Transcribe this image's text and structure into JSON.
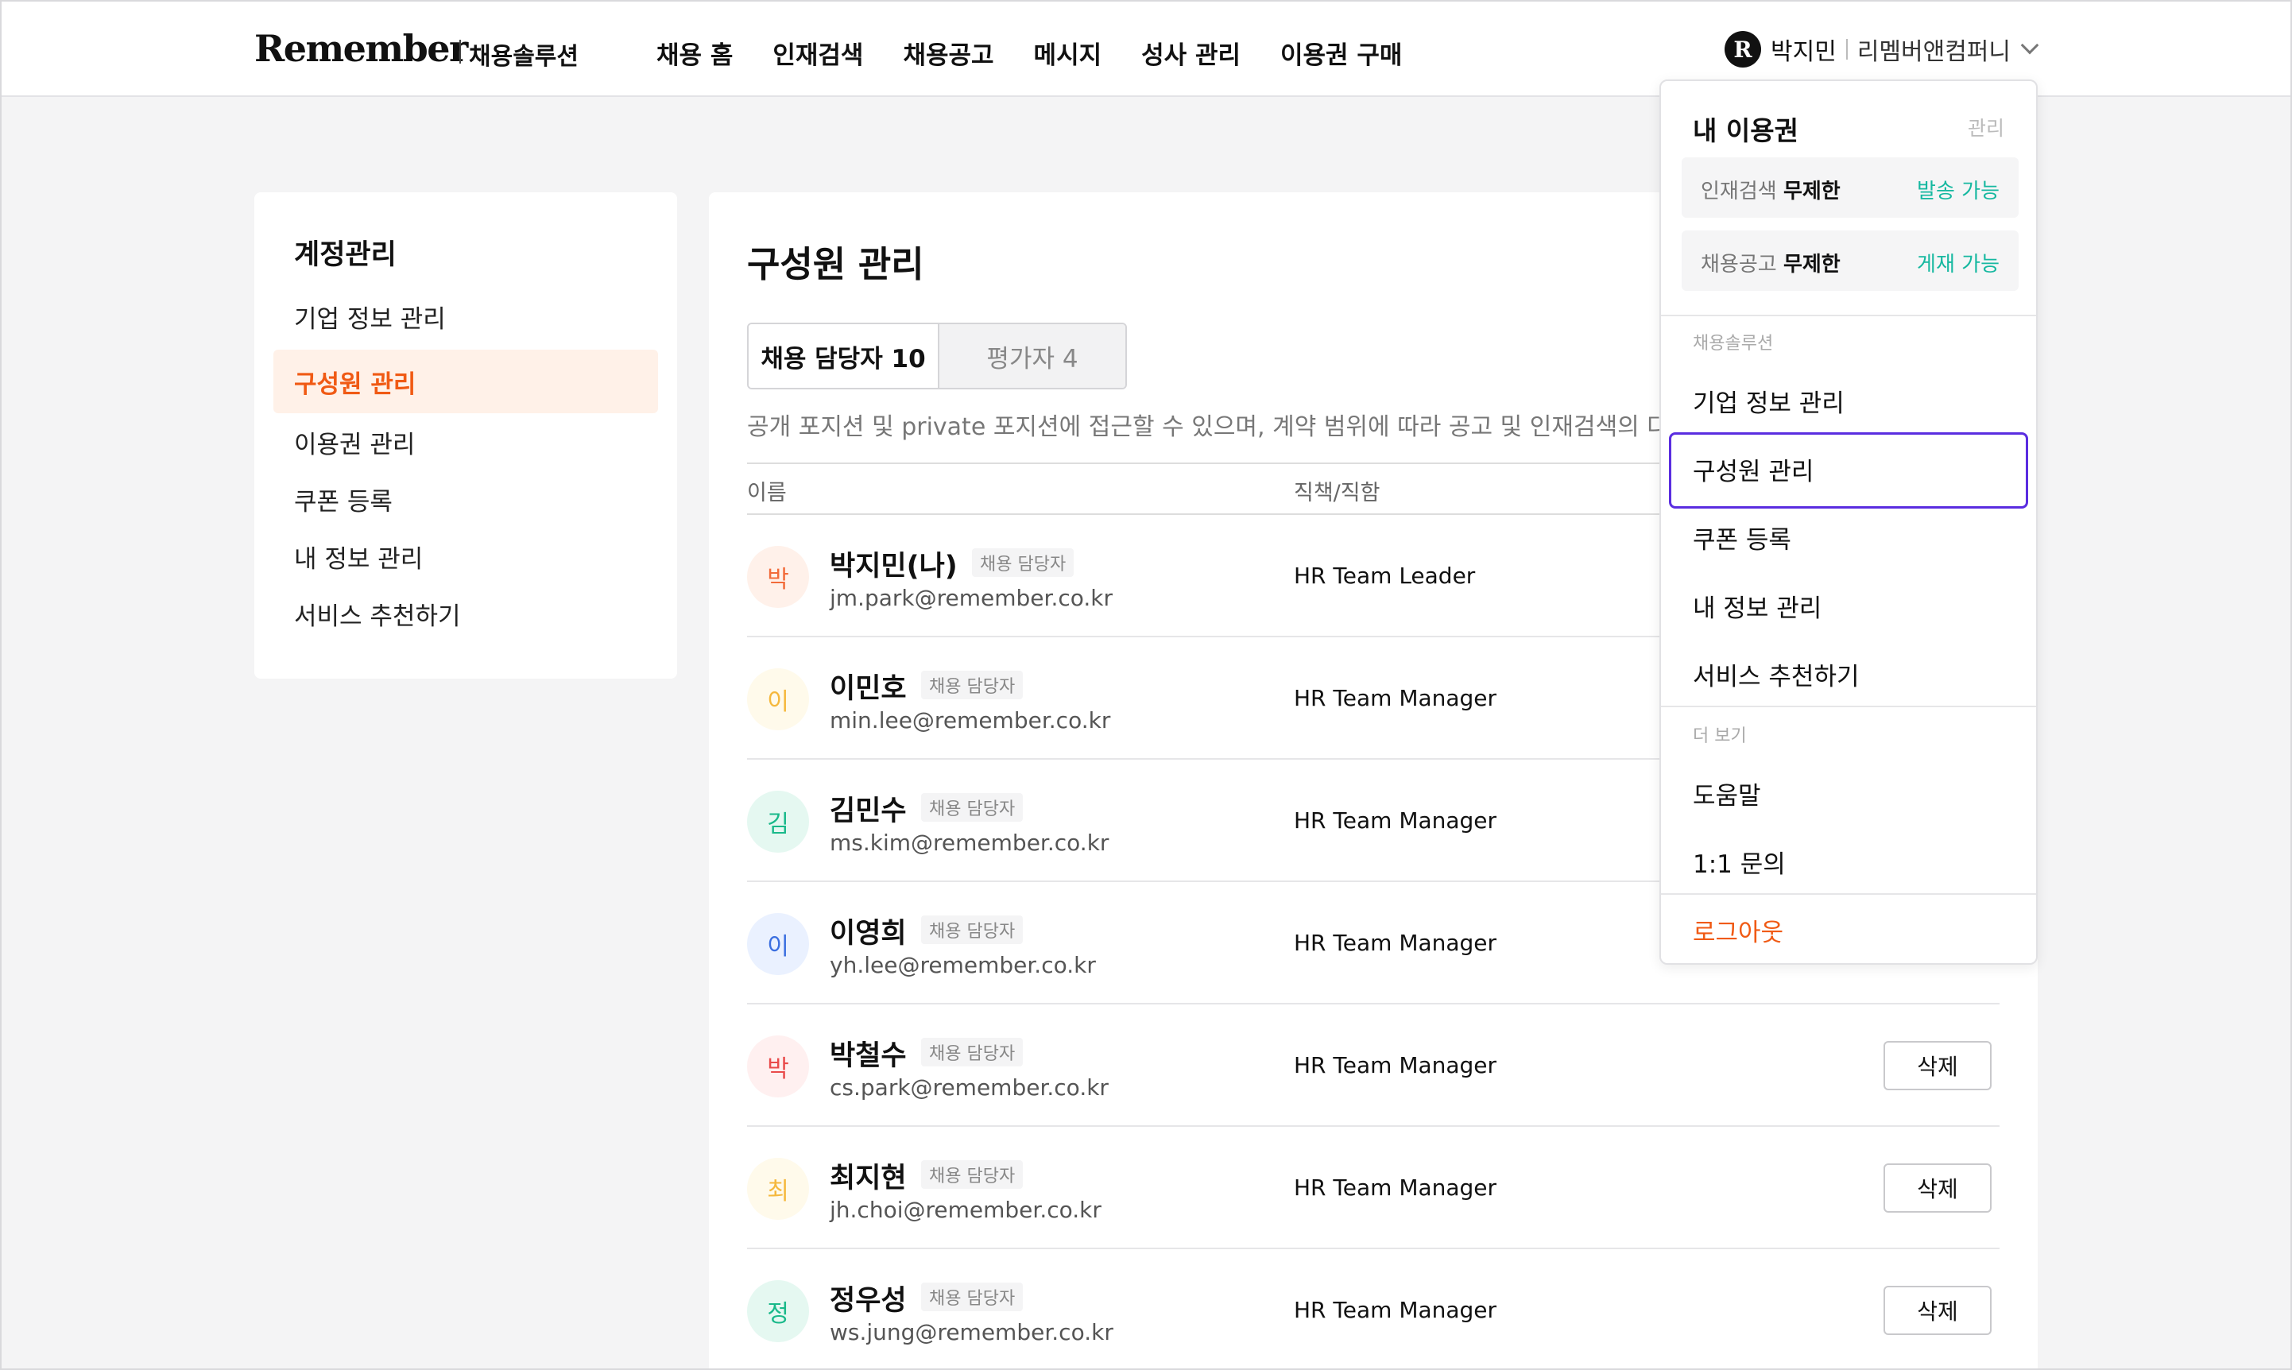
{
  "header": {
    "logo": "Remember",
    "logo_sub": "채용솔루션",
    "nav": [
      "채용 홈",
      "인재검색",
      "채용공고",
      "메시지",
      "성사 관리",
      "이용권 구매"
    ],
    "profile": {
      "avatar": "R",
      "name": "박지민",
      "company": "리멤버앤컴퍼니",
      "chevron_icon": "chevron-down-icon"
    }
  },
  "sidebar": {
    "title": "계정관리",
    "items": [
      {
        "label": "기업 정보 관리",
        "active": false
      },
      {
        "label": "구성원 관리",
        "active": true
      },
      {
        "label": "이용권 관리",
        "active": false
      },
      {
        "label": "쿠폰 등록",
        "active": false
      },
      {
        "label": "내 정보 관리",
        "active": false
      },
      {
        "label": "서비스 추천하기",
        "active": false
      }
    ]
  },
  "main": {
    "title": "구성원 관리",
    "tabs": [
      {
        "label": "채용 담당자 10",
        "active": true
      },
      {
        "label": "평가자 4",
        "active": false
      }
    ],
    "description": "공개 포지션 및 private 포지션에 접근할 수 있으며, 계약 범위에 따라 공고 및 인재검색의 다양",
    "columns": {
      "name": "이름",
      "position": "직책/직함"
    },
    "delete_label": "삭제",
    "members": [
      {
        "initial": "박",
        "name": "박지민(나)",
        "role": "채용 담당자",
        "email": "jm.park@remember.co.kr",
        "position": "HR Team Leader",
        "avatar_bg": "#fff1ea",
        "avatar_color": "#f26b3a",
        "show_delete": false
      },
      {
        "initial": "이",
        "name": "이민호",
        "role": "채용 담당자",
        "email": "min.lee@remember.co.kr",
        "position": "HR Team Manager",
        "avatar_bg": "#fffaeb",
        "avatar_color": "#f5b83d",
        "show_delete": false
      },
      {
        "initial": "김",
        "name": "김민수",
        "role": "채용 담당자",
        "email": "ms.kim@remember.co.kr",
        "position": "HR Team Manager",
        "avatar_bg": "#e5f8f1",
        "avatar_color": "#19b98a",
        "show_delete": false
      },
      {
        "initial": "이",
        "name": "이영희",
        "role": "채용 담당자",
        "email": "yh.lee@remember.co.kr",
        "position": "HR Team Manager",
        "avatar_bg": "#eaf1ff",
        "avatar_color": "#3b6fe0",
        "show_delete": false
      },
      {
        "initial": "박",
        "name": "박철수",
        "role": "채용 담당자",
        "email": "cs.park@remember.co.kr",
        "position": "HR Team Manager",
        "avatar_bg": "#fff0f0",
        "avatar_color": "#e94b4b",
        "show_delete": true
      },
      {
        "initial": "최",
        "name": "최지현",
        "role": "채용 담당자",
        "email": "jh.choi@remember.co.kr",
        "position": "HR Team Manager",
        "avatar_bg": "#fffaeb",
        "avatar_color": "#f5b83d",
        "show_delete": true
      },
      {
        "initial": "정",
        "name": "정우성",
        "role": "채용 담당자",
        "email": "ws.jung@remember.co.kr",
        "position": "HR Team Manager",
        "avatar_bg": "#e5f8f1",
        "avatar_color": "#19b98a",
        "show_delete": true
      }
    ]
  },
  "dropdown": {
    "title": "내 이용권",
    "manage": "관리",
    "licenses": [
      {
        "label": "인재검색",
        "value": "무제한",
        "status": "발송 가능"
      },
      {
        "label": "채용공고",
        "value": "무제한",
        "status": "게재 가능"
      }
    ],
    "section_solution": "채용솔루션",
    "solution_items": [
      "기업 정보 관리",
      "구성원 관리",
      "쿠폰 등록",
      "내 정보 관리",
      "서비스 추천하기"
    ],
    "section_more": "더 보기",
    "more_items": [
      "도움말",
      "1:1 문의"
    ],
    "logout": "로그아웃"
  },
  "colors": {
    "accent": "#f05a14",
    "highlight": "#5a2de0",
    "status_green": "#16b8a0"
  }
}
